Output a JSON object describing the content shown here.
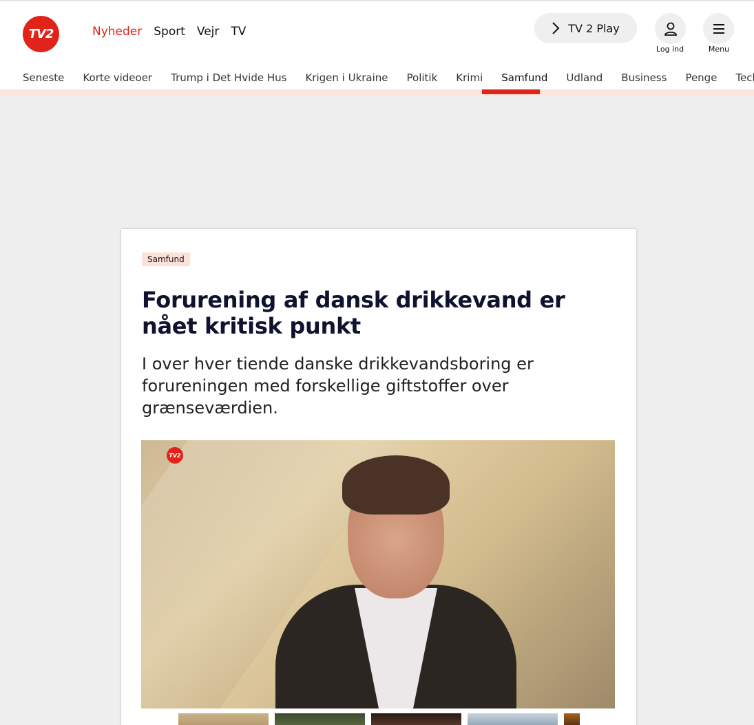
{
  "logo": {
    "text": "TV2"
  },
  "topnav": [
    {
      "label": "Nyheder",
      "active": true
    },
    {
      "label": "Sport",
      "active": false
    },
    {
      "label": "Vejr",
      "active": false
    },
    {
      "label": "TV",
      "active": false
    }
  ],
  "play_button": {
    "label": "TV 2 Play"
  },
  "login": {
    "label": "Log ind"
  },
  "menu": {
    "label": "Menu"
  },
  "subnav": [
    {
      "label": "Seneste"
    },
    {
      "label": "Korte videoer"
    },
    {
      "label": "Trump i Det Hvide Hus"
    },
    {
      "label": "Krigen i Ukraine"
    },
    {
      "label": "Politik"
    },
    {
      "label": "Krimi"
    },
    {
      "label": "Samfund",
      "active": true
    },
    {
      "label": "Udland"
    },
    {
      "label": "Business"
    },
    {
      "label": "Penge"
    },
    {
      "label": "Tech"
    }
  ],
  "article": {
    "tag": "Samfund",
    "headline": "Forurening af dansk drikkevand er nået kritisk punkt",
    "lead": "I over hver tiende danske drikkevandsboring er forureningen med forskellige giftstoffer over grænseværdien.",
    "video_watermark": "TV2"
  },
  "colors": {
    "brand_red": "#e2231a",
    "tag_bg": "#fde1d8",
    "headline": "#0f1330"
  }
}
